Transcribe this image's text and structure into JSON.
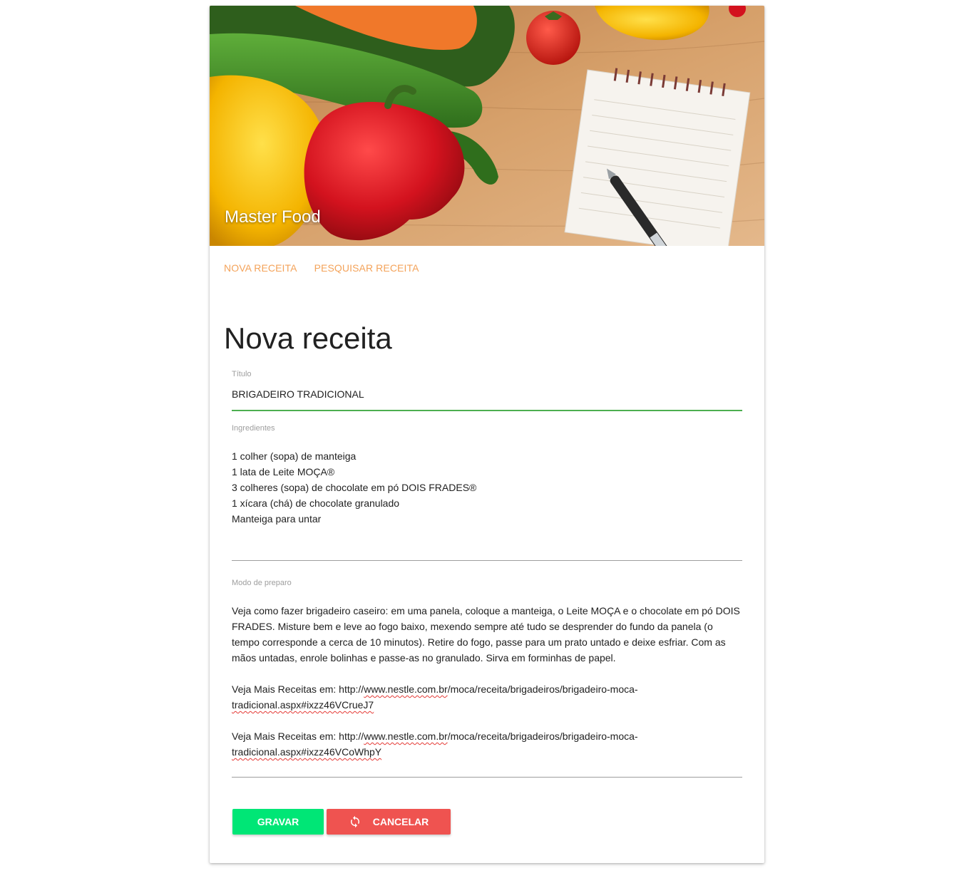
{
  "app": {
    "title": "Master Food"
  },
  "nav": {
    "items": [
      {
        "label": "NOVA RECEITA"
      },
      {
        "label": "PESQUISAR RECEITA"
      }
    ]
  },
  "page": {
    "title": "Nova receita"
  },
  "form": {
    "title_field": {
      "label": "Título",
      "value": "BRIGADEIRO TRADICIONAL"
    },
    "ingredients_field": {
      "label": "Ingredientes",
      "lines": [
        "1 colher (sopa) de manteiga",
        "1 lata de Leite MOÇA®",
        "3 colheres (sopa) de chocolate em pó DOIS FRADES®",
        "1 xícara (chá) de chocolate granulado",
        "Manteiga para untar"
      ]
    },
    "prep_field": {
      "label": "Modo de preparo",
      "paragraph": "Veja como fazer brigadeiro caseiro: em uma panela, coloque a manteiga, o Leite MOÇA e o chocolate em pó DOIS FRADES. Misture bem e leve ao fogo baixo, mexendo sempre até tudo se desprender do fundo da panela (o tempo corresponde a cerca de 10 minutos). Retire do fogo, passe para um prato untado e deixe esfriar. Com as mãos untadas, enrole bolinhas e passe-as no granulado. Sirva em forminhas de papel.",
      "link1": {
        "prefix": "Veja Mais Receitas em: http://",
        "domain": "www.nestle.com.br",
        "path": "/moca/receita/brigadeiros/brigadeiro-moca-",
        "file": "tradicional.aspx",
        "hash": "#ixzz46VCrueJ7"
      },
      "link2": {
        "prefix": "Veja Mais Receitas em: http://",
        "domain": "www.nestle.com.br",
        "path": "/moca/receita/brigadeiros/brigadeiro-moca-",
        "file": "tradicional.aspx",
        "hash": "#ixzz46VCoWhpY"
      }
    }
  },
  "buttons": {
    "save_label": "GRAVAR",
    "cancel_label": "CANCELAR",
    "cancel_icon": "refresh-icon"
  },
  "colors": {
    "accent": "#f4a35a",
    "save": "#00e676",
    "cancel": "#ef5350",
    "active_underline": "#4caf50"
  }
}
